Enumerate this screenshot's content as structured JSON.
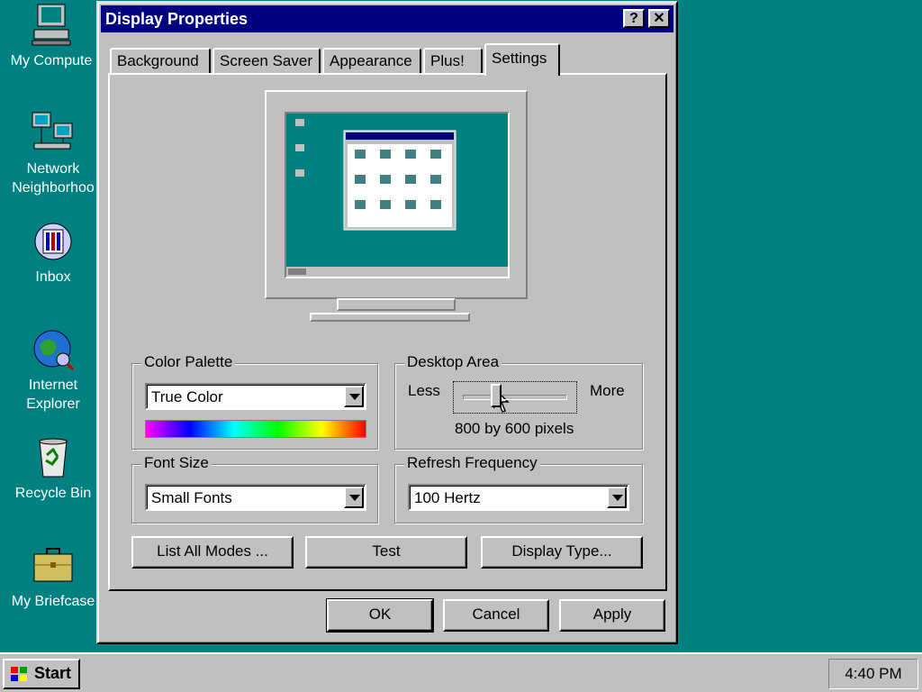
{
  "desktop": {
    "icons": [
      {
        "label": "My Compute",
        "icon": "computer-icon"
      },
      {
        "label": "Network\nNeighborhoo",
        "icon": "network-icon"
      },
      {
        "label": "Inbox",
        "icon": "inbox-icon"
      },
      {
        "label": "Internet\nExplorer",
        "icon": "internet-explorer-icon"
      },
      {
        "label": "Recycle Bin",
        "icon": "recycle-bin-icon"
      },
      {
        "label": "My Briefcase",
        "icon": "briefcase-icon"
      }
    ]
  },
  "window": {
    "title": "Display Properties",
    "help_button": "?",
    "close_button": "✕",
    "tabs": [
      {
        "label": "Background"
      },
      {
        "label": "Screen Saver"
      },
      {
        "label": "Appearance"
      },
      {
        "label": "Plus!"
      },
      {
        "label": "Settings",
        "active": true
      }
    ],
    "color_palette": {
      "label": "Color Palette",
      "selected": "True Color"
    },
    "desktop_area": {
      "label": "Desktop Area",
      "less": "Less",
      "more": "More",
      "value_text": "800 by 600 pixels",
      "slider_position": 0.3
    },
    "font_size": {
      "label": "Font Size",
      "selected": "Small Fonts"
    },
    "refresh_frequency": {
      "label": "Refresh Frequency",
      "selected": "100 Hertz"
    },
    "buttons": {
      "list_all_modes": "List All Modes ...",
      "test": "Test",
      "display_type": "Display Type..."
    },
    "footer": {
      "ok": "OK",
      "cancel": "Cancel",
      "apply": "Apply"
    }
  },
  "taskbar": {
    "start": "Start",
    "clock": "4:40 PM"
  },
  "colors": {
    "desktop": "#008080",
    "titlebar": "#000080",
    "face": "#c0c0c0"
  }
}
